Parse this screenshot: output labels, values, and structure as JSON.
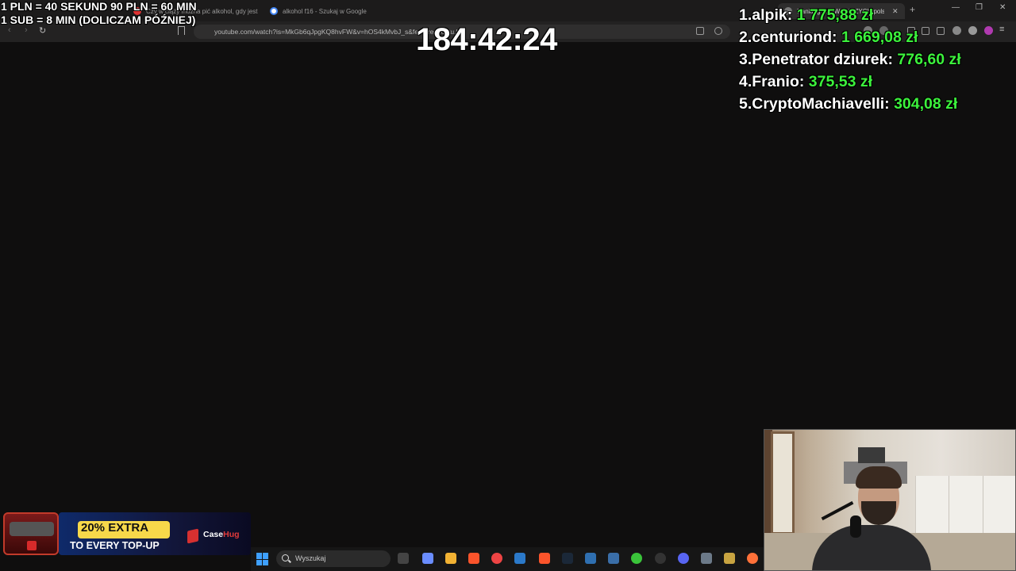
{
  "browser": {
    "tabs": [
      {
        "label": "1 PLN = 40 SEKUND 90 PLN = 60 MIN"
      },
      {
        "label": "Czy w ciąży można pić alkohol, gdy jest w ciąży? ..."
      },
      {
        "label": "alkohol f16 - Szukaj w Google"
      },
      {
        "label": "Ranking NAJWIĘKSZYCH polskich ..."
      }
    ],
    "url": "youtube.com/watch?is=MkGb6qJpgKQ8hvFW&v=hOS4kMvbJ_s&feature=youtu.be"
  },
  "overlay": {
    "rules_line1": "1 PLN = 40 SEKUND 90 PLN = 60 MIN",
    "rules_line2": "1 SUB = 8 MIN (DOLICZAM PÓŹNIEJ)",
    "timer": "184:42:24",
    "ranking": [
      {
        "rank": "1.",
        "name": "alpik:",
        "amount": "1 775,88 zł"
      },
      {
        "rank": "2.",
        "name": "centuriond:",
        "amount": "1 669,08 zł"
      },
      {
        "rank": "3.",
        "name": "Penetrator dziurek:",
        "amount": "776,60 zł"
      },
      {
        "rank": "4.",
        "name": "Franio:",
        "amount": "375,53 zł"
      },
      {
        "rank": "5.",
        "name": "CryptoMachiavelli:",
        "amount": "304,08 zł"
      }
    ]
  },
  "promo": {
    "line1": "20% EXTRA",
    "line2": "TO EVERY TOP-UP",
    "brand_a": "Case",
    "brand_b": "Hug"
  },
  "taskbar": {
    "search_placeholder": "Wyszukaj"
  },
  "colors": {
    "background": "#0f0e0e",
    "ranking_amount": "#3cf23c",
    "promo_accent": "#f7d84a"
  }
}
